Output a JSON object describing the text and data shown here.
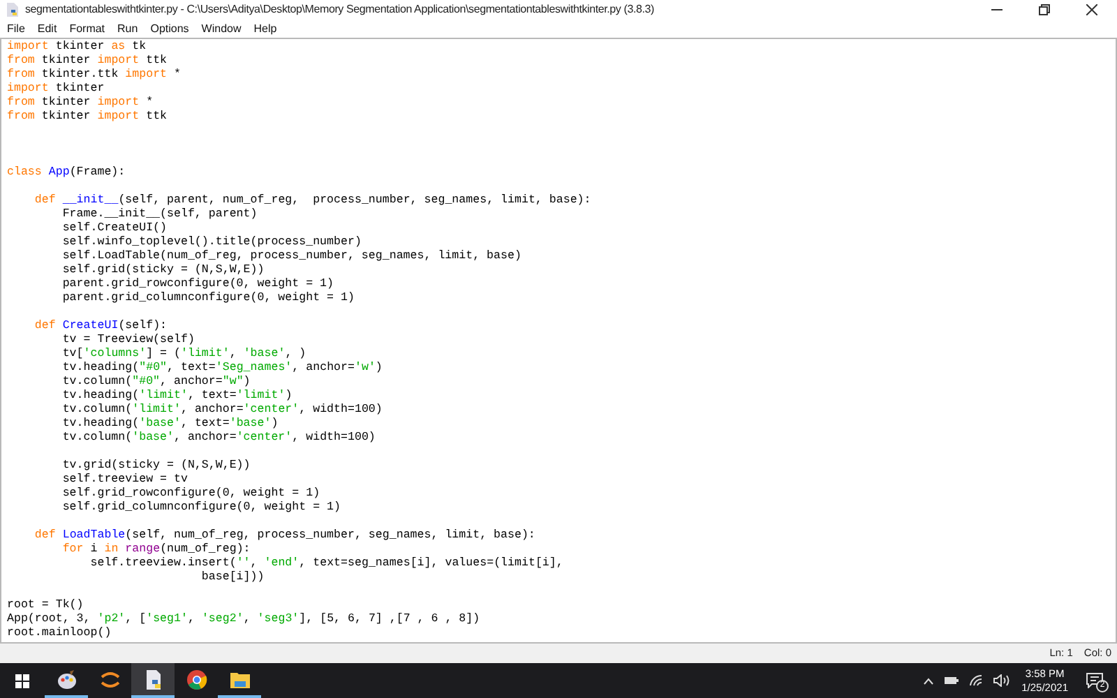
{
  "window": {
    "title": "segmentationtableswithtkinter.py - C:\\Users\\Aditya\\Desktop\\Memory Segmentation Application\\segmentationtableswithtkinter.py (3.8.3)"
  },
  "menu": [
    "File",
    "Edit",
    "Format",
    "Run",
    "Options",
    "Window",
    "Help"
  ],
  "editor": {
    "lines": [
      {
        "kind": "code",
        "tokens": [
          {
            "text": "import",
            "kind": "keyword"
          },
          {
            "text": " tkinter ",
            "kind": "plain"
          },
          {
            "text": "as",
            "kind": "keyword"
          },
          {
            "text": " tk",
            "kind": "plain"
          }
        ]
      },
      {
        "kind": "code",
        "tokens": [
          {
            "text": "from",
            "kind": "keyword"
          },
          {
            "text": " tkinter ",
            "kind": "plain"
          },
          {
            "text": "import",
            "kind": "keyword"
          },
          {
            "text": " ttk",
            "kind": "plain"
          }
        ]
      },
      {
        "kind": "code",
        "tokens": [
          {
            "text": "from",
            "kind": "keyword"
          },
          {
            "text": " tkinter.ttk ",
            "kind": "plain"
          },
          {
            "text": "import",
            "kind": "keyword"
          },
          {
            "text": " *",
            "kind": "plain"
          }
        ]
      },
      {
        "kind": "code",
        "tokens": [
          {
            "text": "import",
            "kind": "keyword"
          },
          {
            "text": " tkinter",
            "kind": "plain"
          }
        ]
      },
      {
        "kind": "code",
        "tokens": [
          {
            "text": "from",
            "kind": "keyword"
          },
          {
            "text": " tkinter ",
            "kind": "plain"
          },
          {
            "text": "import",
            "kind": "keyword"
          },
          {
            "text": " *",
            "kind": "plain"
          }
        ]
      },
      {
        "kind": "code",
        "tokens": [
          {
            "text": "from",
            "kind": "keyword"
          },
          {
            "text": " tkinter ",
            "kind": "plain"
          },
          {
            "text": "import",
            "kind": "keyword"
          },
          {
            "text": " ttk",
            "kind": "plain"
          }
        ]
      },
      {
        "kind": "blank"
      },
      {
        "kind": "blank"
      },
      {
        "kind": "blank"
      },
      {
        "kind": "code",
        "tokens": [
          {
            "text": "class ",
            "kind": "keyword"
          },
          {
            "text": "App",
            "kind": "definition"
          },
          {
            "text": "(Frame):",
            "kind": "plain"
          }
        ]
      },
      {
        "kind": "blank"
      },
      {
        "kind": "code",
        "tokens": [
          {
            "text": "    def ",
            "kind": "keyword"
          },
          {
            "text": "__init__",
            "kind": "definition"
          },
          {
            "text": "(self, parent, num_of_reg,  process_number, seg_names, limit, base):",
            "kind": "plain"
          }
        ]
      },
      {
        "kind": "code",
        "tokens": [
          {
            "text": "        Frame.__init__(self, parent)",
            "kind": "plain"
          }
        ]
      },
      {
        "kind": "code",
        "tokens": [
          {
            "text": "        self.CreateUI()",
            "kind": "plain"
          }
        ]
      },
      {
        "kind": "code",
        "tokens": [
          {
            "text": "        self.winfo_toplevel().title(process_number)",
            "kind": "plain"
          }
        ]
      },
      {
        "kind": "code",
        "tokens": [
          {
            "text": "        self.LoadTable(num_of_reg, process_number, seg_names, limit, base)",
            "kind": "plain"
          }
        ]
      },
      {
        "kind": "code",
        "tokens": [
          {
            "text": "        self.grid(sticky = (N,S,W,E))",
            "kind": "plain"
          }
        ]
      },
      {
        "kind": "code",
        "tokens": [
          {
            "text": "        parent.grid_rowconfigure(0, weight = 1)",
            "kind": "plain"
          }
        ]
      },
      {
        "kind": "code",
        "tokens": [
          {
            "text": "        parent.grid_columnconfigure(0, weight = 1)",
            "kind": "plain"
          }
        ]
      },
      {
        "kind": "blank"
      },
      {
        "kind": "code",
        "tokens": [
          {
            "text": "    def ",
            "kind": "keyword"
          },
          {
            "text": "CreateUI",
            "kind": "definition"
          },
          {
            "text": "(self):",
            "kind": "plain"
          }
        ]
      },
      {
        "kind": "code",
        "tokens": [
          {
            "text": "        tv = Treeview(self)",
            "kind": "plain"
          }
        ]
      },
      {
        "kind": "code",
        "tokens": [
          {
            "text": "        tv[",
            "kind": "plain"
          },
          {
            "text": "'columns'",
            "kind": "string"
          },
          {
            "text": "] = (",
            "kind": "plain"
          },
          {
            "text": "'limit'",
            "kind": "string"
          },
          {
            "text": ", ",
            "kind": "plain"
          },
          {
            "text": "'base'",
            "kind": "string"
          },
          {
            "text": ", )",
            "kind": "plain"
          }
        ]
      },
      {
        "kind": "code",
        "tokens": [
          {
            "text": "        tv.heading(",
            "kind": "plain"
          },
          {
            "text": "\"#0\"",
            "kind": "string"
          },
          {
            "text": ", text=",
            "kind": "plain"
          },
          {
            "text": "'Seg_names'",
            "kind": "string"
          },
          {
            "text": ", anchor=",
            "kind": "plain"
          },
          {
            "text": "'w'",
            "kind": "string"
          },
          {
            "text": ")",
            "kind": "plain"
          }
        ]
      },
      {
        "kind": "code",
        "tokens": [
          {
            "text": "        tv.column(",
            "kind": "plain"
          },
          {
            "text": "\"#0\"",
            "kind": "string"
          },
          {
            "text": ", anchor=",
            "kind": "plain"
          },
          {
            "text": "\"w\"",
            "kind": "string"
          },
          {
            "text": ")",
            "kind": "plain"
          }
        ]
      },
      {
        "kind": "code",
        "tokens": [
          {
            "text": "        tv.heading(",
            "kind": "plain"
          },
          {
            "text": "'limit'",
            "kind": "string"
          },
          {
            "text": ", text=",
            "kind": "plain"
          },
          {
            "text": "'limit'",
            "kind": "string"
          },
          {
            "text": ")",
            "kind": "plain"
          }
        ]
      },
      {
        "kind": "code",
        "tokens": [
          {
            "text": "        tv.column(",
            "kind": "plain"
          },
          {
            "text": "'limit'",
            "kind": "string"
          },
          {
            "text": ", anchor=",
            "kind": "plain"
          },
          {
            "text": "'center'",
            "kind": "string"
          },
          {
            "text": ", width=100)",
            "kind": "plain"
          }
        ]
      },
      {
        "kind": "code",
        "tokens": [
          {
            "text": "        tv.heading(",
            "kind": "plain"
          },
          {
            "text": "'base'",
            "kind": "string"
          },
          {
            "text": ", text=",
            "kind": "plain"
          },
          {
            "text": "'base'",
            "kind": "string"
          },
          {
            "text": ")",
            "kind": "plain"
          }
        ]
      },
      {
        "kind": "code",
        "tokens": [
          {
            "text": "        tv.column(",
            "kind": "plain"
          },
          {
            "text": "'base'",
            "kind": "string"
          },
          {
            "text": ", anchor=",
            "kind": "plain"
          },
          {
            "text": "'center'",
            "kind": "string"
          },
          {
            "text": ", width=100)",
            "kind": "plain"
          }
        ]
      },
      {
        "kind": "blank"
      },
      {
        "kind": "code",
        "tokens": [
          {
            "text": "        tv.grid(sticky = (N,S,W,E))",
            "kind": "plain"
          }
        ]
      },
      {
        "kind": "code",
        "tokens": [
          {
            "text": "        self.treeview = tv",
            "kind": "plain"
          }
        ]
      },
      {
        "kind": "code",
        "tokens": [
          {
            "text": "        self.grid_rowconfigure(0, weight = 1)",
            "kind": "plain"
          }
        ]
      },
      {
        "kind": "code",
        "tokens": [
          {
            "text": "        self.grid_columnconfigure(0, weight = 1)",
            "kind": "plain"
          }
        ]
      },
      {
        "kind": "blank"
      },
      {
        "kind": "code",
        "tokens": [
          {
            "text": "    def ",
            "kind": "keyword"
          },
          {
            "text": "LoadTable",
            "kind": "definition"
          },
          {
            "text": "(self, num_of_reg, process_number, seg_names, limit, base):",
            "kind": "plain"
          }
        ]
      },
      {
        "kind": "code",
        "tokens": [
          {
            "text": "        for",
            "kind": "keyword"
          },
          {
            "text": " i ",
            "kind": "plain"
          },
          {
            "text": "in ",
            "kind": "keyword"
          },
          {
            "text": "range",
            "kind": "builtin"
          },
          {
            "text": "(num_of_reg):",
            "kind": "plain"
          }
        ]
      },
      {
        "kind": "code",
        "tokens": [
          {
            "text": "            self.treeview.insert(",
            "kind": "plain"
          },
          {
            "text": "''",
            "kind": "string"
          },
          {
            "text": ", ",
            "kind": "plain"
          },
          {
            "text": "'end'",
            "kind": "string"
          },
          {
            "text": ", text=seg_names[i], values=(limit[i],",
            "kind": "plain"
          }
        ]
      },
      {
        "kind": "code",
        "tokens": [
          {
            "text": "                            base[i]))",
            "kind": "plain"
          }
        ]
      },
      {
        "kind": "blank"
      },
      {
        "kind": "code",
        "tokens": [
          {
            "text": "root = Tk()",
            "kind": "plain"
          }
        ]
      },
      {
        "kind": "code",
        "tokens": [
          {
            "text": "App(root, 3, ",
            "kind": "plain"
          },
          {
            "text": "'p2'",
            "kind": "string"
          },
          {
            "text": ", [",
            "kind": "plain"
          },
          {
            "text": "'seg1'",
            "kind": "string"
          },
          {
            "text": ", ",
            "kind": "plain"
          },
          {
            "text": "'seg2'",
            "kind": "string"
          },
          {
            "text": ", ",
            "kind": "plain"
          },
          {
            "text": "'seg3'",
            "kind": "string"
          },
          {
            "text": "], [5, 6, 7] ,[7 , 6 , 8])",
            "kind": "plain"
          }
        ]
      },
      {
        "kind": "code",
        "tokens": [
          {
            "text": "root.mainloop()",
            "kind": "plain"
          }
        ]
      }
    ]
  },
  "status_bar": {
    "line": "Ln: 1",
    "column": "Col: 0"
  },
  "taskbar": {
    "apps": [
      {
        "kind": "paint",
        "running": true,
        "selected": false
      },
      {
        "kind": "swirl",
        "running": false,
        "selected": false
      },
      {
        "kind": "python",
        "running": true,
        "selected": true
      },
      {
        "kind": "browser",
        "running": false,
        "selected": false
      },
      {
        "kind": "folder",
        "running": true,
        "selected": false
      }
    ],
    "time": "3:58 PM",
    "date": "1/25/2021",
    "notifications": "2"
  }
}
